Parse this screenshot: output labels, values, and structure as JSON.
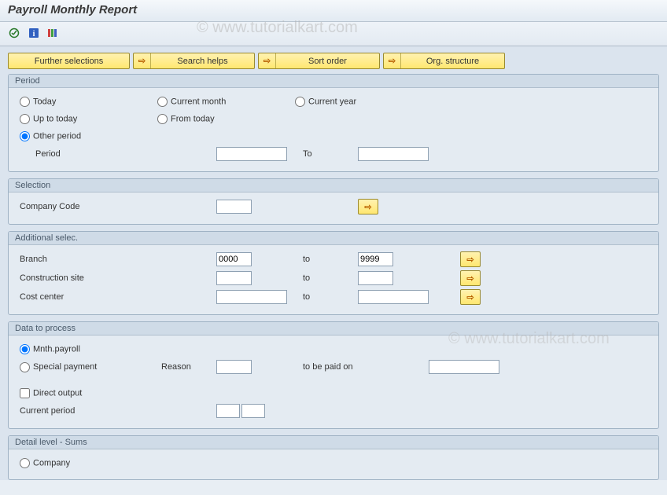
{
  "title": "Payroll Monthly Report",
  "watermark": "© www.tutorialkart.com",
  "top_buttons": {
    "further": "Further selections",
    "search": "Search helps",
    "sort": "Sort order",
    "org": "Org. structure"
  },
  "period": {
    "group_title": "Period",
    "today": "Today",
    "current_month": "Current month",
    "current_year": "Current year",
    "up_to_today": "Up to today",
    "from_today": "From today",
    "other_period": "Other period",
    "period_label": "Period",
    "to_label": "To",
    "period_from": "",
    "period_to": ""
  },
  "selection": {
    "group_title": "Selection",
    "company_code_label": "Company Code",
    "company_code": ""
  },
  "additional": {
    "group_title": "Additional selec.",
    "branch_label": "Branch",
    "branch_from": "0000",
    "branch_to": "9999",
    "construction_label": "Construction site",
    "construction_from": "",
    "construction_to": "",
    "cost_center_label": "Cost center",
    "cost_center_from": "",
    "cost_center_to": "",
    "to_label": "to"
  },
  "data_process": {
    "group_title": "Data to process",
    "mnth_payroll": "Mnth.payroll",
    "special_payment": "Special payment",
    "reason_label": "Reason",
    "reason": "",
    "paid_on_label": "to be paid on",
    "paid_on": "",
    "direct_output": "Direct output",
    "current_period_label": "Current period",
    "cp1": "",
    "cp2": ""
  },
  "detail": {
    "group_title": "Detail level - Sums",
    "company": "Company"
  }
}
